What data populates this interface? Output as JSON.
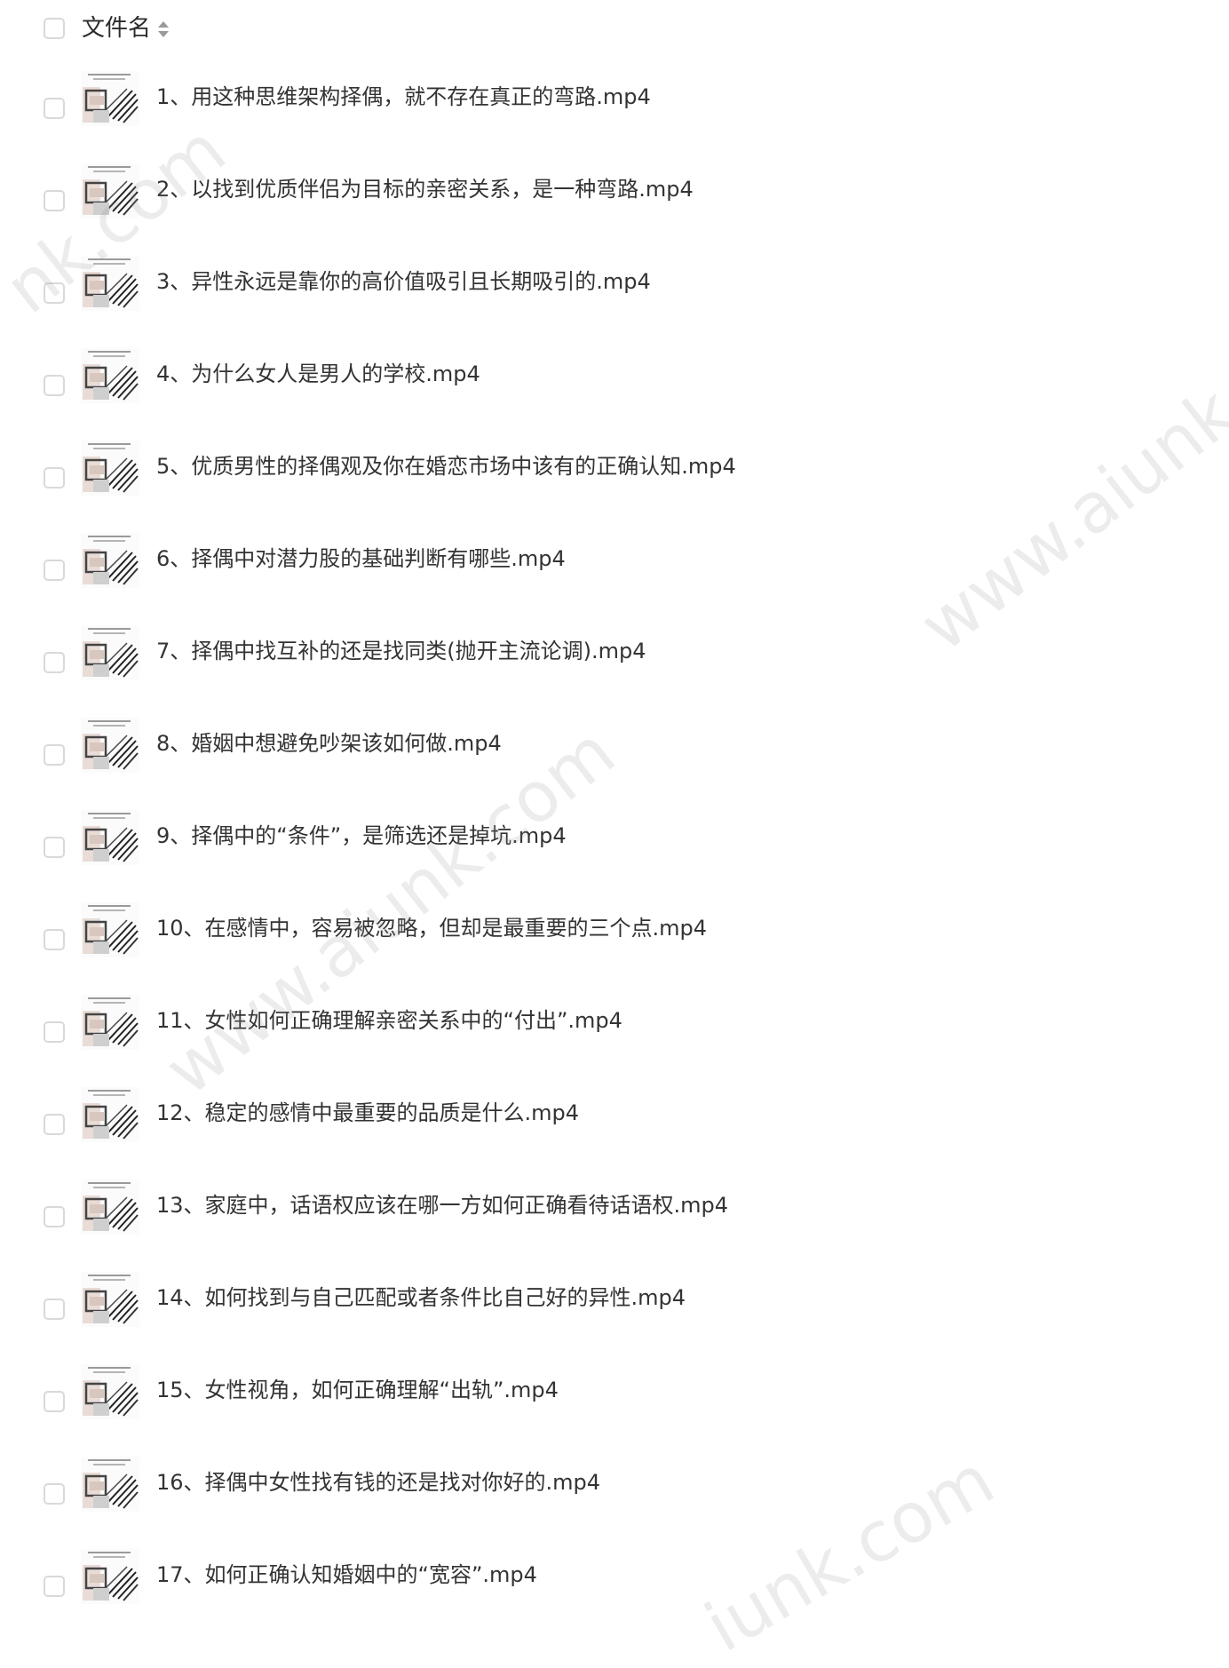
{
  "header": {
    "label": "文件名",
    "sort_icon": "sort-icon"
  },
  "rows": [
    {
      "name": "1、用这种思维架构择偶，就不存在真正的弯路.mp4"
    },
    {
      "name": "2、以找到优质伴侣为目标的亲密关系，是一种弯路.mp4"
    },
    {
      "name": "3、异性永远是靠你的高价值吸引且长期吸引的.mp4"
    },
    {
      "name": "4、为什么女人是男人的学校.mp4"
    },
    {
      "name": "5、优质男性的择偶观及你在婚恋市场中该有的正确认知.mp4"
    },
    {
      "name": "6、择偶中对潜力股的基础判断有哪些.mp4"
    },
    {
      "name": "7、择偶中找互补的还是找同类(抛开主流论调).mp4"
    },
    {
      "name": "8、婚姻中想避免吵架该如何做.mp4"
    },
    {
      "name": "9、择偶中的“条件”，是筛选还是掉坑.mp4"
    },
    {
      "name": "10、在感情中，容易被忽略，但却是最重要的三个点.mp4"
    },
    {
      "name": "11、女性如何正确理解亲密关系中的“付出”.mp4"
    },
    {
      "name": "12、稳定的感情中最重要的品质是什么.mp4"
    },
    {
      "name": "13、家庭中，话语权应该在哪一方如何正确看待话语权.mp4"
    },
    {
      "name": "14、如何找到与自己匹配或者条件比自己好的异性.mp4"
    },
    {
      "name": "15、女性视角，如何正确理解“出轨”.mp4"
    },
    {
      "name": "16、择偶中女性找有钱的还是找对你好的.mp4"
    },
    {
      "name": "17、如何正确认知婚姻中的“宽容”.mp4"
    }
  ],
  "watermarks": [
    "nk.com",
    "www.aiunk.c",
    "www.aiunk.com",
    "iunk.com"
  ],
  "colors": {
    "checkbox_border": "#d9d9d9",
    "text": "#333333",
    "watermark": "#969696"
  }
}
